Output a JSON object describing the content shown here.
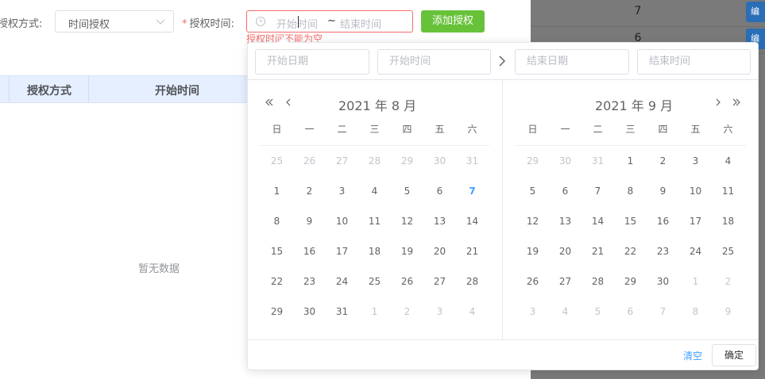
{
  "filters": {
    "auth_method_label": "授权方式:",
    "auth_method_value": "时间授权",
    "auth_time_required": "*",
    "auth_time_label": "授权时间:",
    "range_start_placeholder": "开始时间",
    "range_separator": "~",
    "range_end_placeholder": "结束时间",
    "error_message": "授权时间不能为空",
    "add_button": "添加授权"
  },
  "table": {
    "headers": [
      "授权方式",
      "开始时间"
    ],
    "empty_text": "暂无数据"
  },
  "background_rows": [
    {
      "value": "7",
      "button": "编"
    },
    {
      "value": "6",
      "button": "编"
    }
  ],
  "picker": {
    "start_date_placeholder": "开始日期",
    "start_time_placeholder": "开始时间",
    "end_date_placeholder": "结束日期",
    "end_time_placeholder": "结束时间",
    "weekdays": [
      "日",
      "一",
      "二",
      "三",
      "四",
      "五",
      "六"
    ],
    "left_title": "2021 年 8 月",
    "right_title": "2021 年 9 月",
    "left_days": [
      [
        "25",
        "m"
      ],
      [
        "26",
        "m"
      ],
      [
        "27",
        "m"
      ],
      [
        "28",
        "m"
      ],
      [
        "29",
        "m"
      ],
      [
        "30",
        "m"
      ],
      [
        "31",
        "m"
      ],
      [
        "1",
        ""
      ],
      [
        "2",
        ""
      ],
      [
        "3",
        ""
      ],
      [
        "4",
        ""
      ],
      [
        "5",
        ""
      ],
      [
        "6",
        ""
      ],
      [
        "7",
        "today"
      ],
      [
        "8",
        ""
      ],
      [
        "9",
        ""
      ],
      [
        "10",
        ""
      ],
      [
        "11",
        ""
      ],
      [
        "12",
        ""
      ],
      [
        "13",
        ""
      ],
      [
        "14",
        ""
      ],
      [
        "15",
        ""
      ],
      [
        "16",
        ""
      ],
      [
        "17",
        ""
      ],
      [
        "18",
        ""
      ],
      [
        "19",
        ""
      ],
      [
        "20",
        ""
      ],
      [
        "21",
        ""
      ],
      [
        "22",
        ""
      ],
      [
        "23",
        ""
      ],
      [
        "24",
        ""
      ],
      [
        "25",
        ""
      ],
      [
        "26",
        ""
      ],
      [
        "27",
        ""
      ],
      [
        "28",
        ""
      ],
      [
        "29",
        ""
      ],
      [
        "30",
        ""
      ],
      [
        "31",
        ""
      ],
      [
        "1",
        "m"
      ],
      [
        "2",
        "m"
      ],
      [
        "3",
        "m"
      ],
      [
        "4",
        "m"
      ]
    ],
    "right_days": [
      [
        "29",
        "m"
      ],
      [
        "30",
        "m"
      ],
      [
        "31",
        "m"
      ],
      [
        "1",
        ""
      ],
      [
        "2",
        ""
      ],
      [
        "3",
        ""
      ],
      [
        "4",
        ""
      ],
      [
        "5",
        ""
      ],
      [
        "6",
        ""
      ],
      [
        "7",
        ""
      ],
      [
        "8",
        ""
      ],
      [
        "9",
        ""
      ],
      [
        "10",
        ""
      ],
      [
        "11",
        ""
      ],
      [
        "12",
        ""
      ],
      [
        "13",
        ""
      ],
      [
        "14",
        ""
      ],
      [
        "15",
        ""
      ],
      [
        "16",
        ""
      ],
      [
        "17",
        ""
      ],
      [
        "18",
        ""
      ],
      [
        "19",
        ""
      ],
      [
        "20",
        ""
      ],
      [
        "21",
        ""
      ],
      [
        "22",
        ""
      ],
      [
        "23",
        ""
      ],
      [
        "24",
        ""
      ],
      [
        "25",
        ""
      ],
      [
        "26",
        ""
      ],
      [
        "27",
        ""
      ],
      [
        "28",
        ""
      ],
      [
        "29",
        ""
      ],
      [
        "30",
        ""
      ],
      [
        "1",
        "m"
      ],
      [
        "2",
        "m"
      ],
      [
        "3",
        "m"
      ],
      [
        "4",
        "m"
      ],
      [
        "5",
        "m"
      ],
      [
        "6",
        "m"
      ],
      [
        "7",
        "m"
      ],
      [
        "8",
        "m"
      ],
      [
        "9",
        "m"
      ]
    ],
    "clear_label": "清空",
    "confirm_label": "确定"
  },
  "colors": {
    "accent": "#409eff",
    "success": "#67c23a",
    "danger": "#f56c6c",
    "table_header": "#e5efff"
  }
}
